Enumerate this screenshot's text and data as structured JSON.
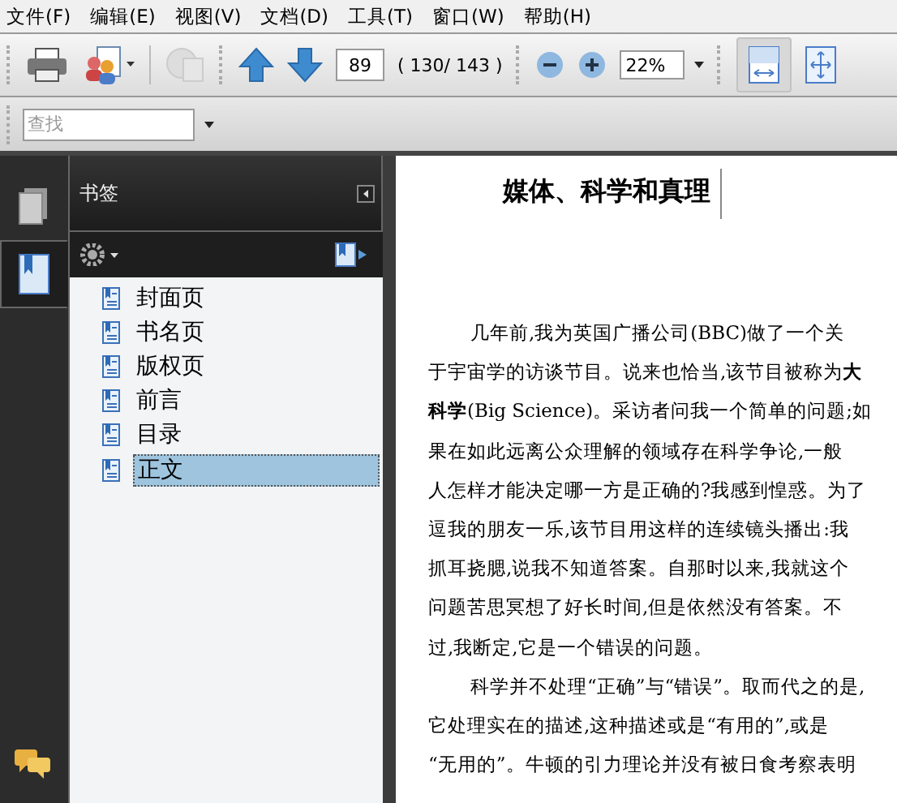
{
  "menu": [
    "文件(F)",
    "编辑(E)",
    "视图(V)",
    "文档(D)",
    "工具(T)",
    "窗口(W)",
    "帮助(H)"
  ],
  "toolbar": {
    "page_number": "89",
    "page_count": "( 130/ 143 )",
    "zoom": "22%",
    "fit_width_selected": true
  },
  "find": {
    "placeholder": "查找"
  },
  "panel": {
    "title": "书签",
    "side_tabs": [
      {
        "kind": "pages",
        "selected": false
      },
      {
        "kind": "bookmarks",
        "selected": true
      }
    ],
    "bookmarks": [
      {
        "label": "封面页",
        "selected": false
      },
      {
        "label": "书名页",
        "selected": false
      },
      {
        "label": "版权页",
        "selected": false
      },
      {
        "label": "前言",
        "selected": false
      },
      {
        "label": "目录",
        "selected": false
      },
      {
        "label": "正文",
        "selected": true
      }
    ]
  },
  "document": {
    "heading": "媒体、科学和真理",
    "paragraphs": [
      {
        "lines": [
          "几年前,我为英国广播公司(BBC)做了一个关",
          "于宇宙学的访谈节目。说来也恰当,该节目被称为**大**",
          "**科学**(Big Science)。采访者问我一个简单的问题;如",
          "果在如此远离公众理解的领域存在科学争论,一般",
          "人怎样才能决定哪一方是正确的?我感到惶惑。为了",
          "逗我的朋友一乐,该节目用这样的连续镜头播出:我",
          "抓耳挠腮,说我不知道答案。自那时以来,我就这个",
          "问题苦思冥想了好长时间,但是依然没有答案。不",
          "过,我断定,它是一个错误的问题。"
        ]
      },
      {
        "lines": [
          "科学并不处理“正确”与“错误”。取而代之的是,",
          "它处理实在的描述,这种描述或是“有用的”,或是",
          "“无用的”。牛顿的引力理论并没有被日食考察表明"
        ]
      }
    ]
  }
}
